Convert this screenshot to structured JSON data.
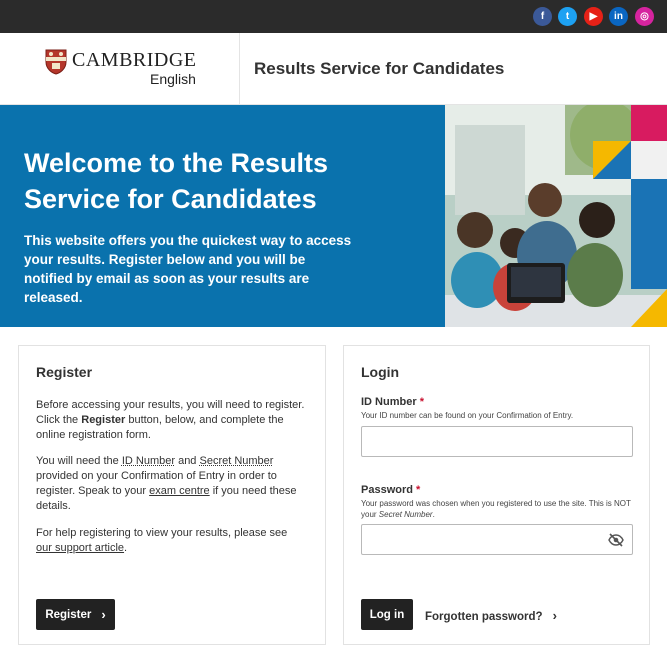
{
  "social": {
    "facebook": "f",
    "twitter": "t",
    "youtube": "▶",
    "linkedin": "in",
    "instagram": "◎"
  },
  "header": {
    "logo_name": "CAMBRIDGE",
    "logo_sub": "English",
    "title": "Results Service for Candidates"
  },
  "hero": {
    "title": "Welcome to the Results Service for Candidates",
    "body": "This website offers you the quickest way to access your results. Register below and you will be notified by email as soon as your results are released."
  },
  "register": {
    "title": "Register",
    "p1_a": "Before accessing your results, you will need to register. Click the ",
    "p1_b": "Register",
    "p1_c": " button, below, and complete the online registration form.",
    "p2_a": "You will need the ",
    "p2_id": "ID Number",
    "p2_and": " and ",
    "p2_secret": "Secret Number",
    "p2_b": " provided on your Confirmation of Entry in order to register. Speak to your ",
    "p2_centre": "exam centre",
    "p2_c": " if you need these details.",
    "p3_a": "For help registering to view your results, please see ",
    "p3_link": "our support article",
    "p3_b": ".",
    "button": "Register"
  },
  "login": {
    "title": "Login",
    "id_label": "ID Number",
    "required_mark": "*",
    "id_help": "Your ID number can be found on your Confirmation of Entry.",
    "id_value": "",
    "password_label": "Password",
    "password_help_a": "Your password was chosen when you registered to use the site. This is NOT your ",
    "password_help_em": "Secret Number",
    "password_help_b": ".",
    "password_value": "",
    "login_button": "Log in",
    "forgot": "Forgotten password?"
  },
  "colors": {
    "hero_blue": "#0a72ad",
    "dark_button": "#222222",
    "required": "#c8102e"
  }
}
